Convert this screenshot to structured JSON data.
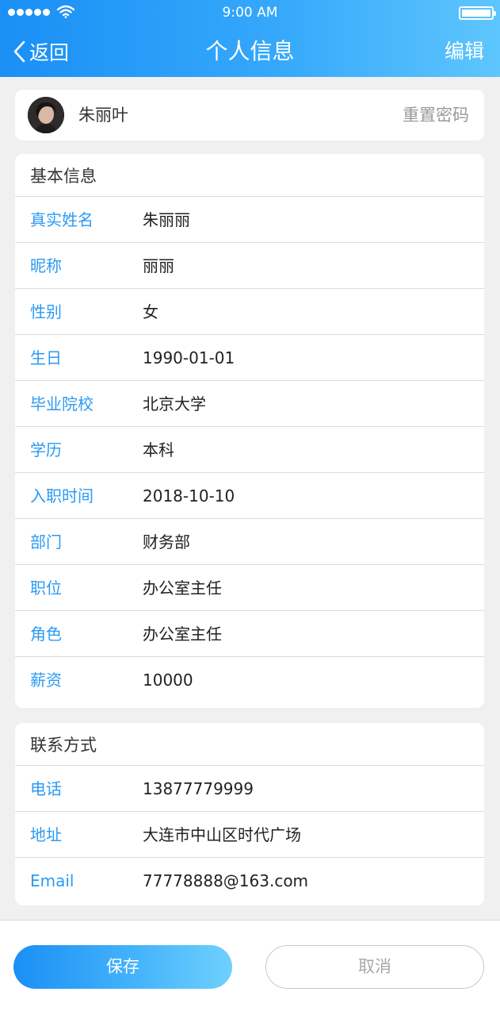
{
  "status_bar": {
    "time": "9:00 AM"
  },
  "nav": {
    "back_label": "返回",
    "title": "个人信息",
    "edit_label": "编辑"
  },
  "profile": {
    "name": "朱丽叶",
    "reset_password": "重置密码"
  },
  "basic_info": {
    "title": "基本信息",
    "rows": [
      {
        "label": "真实姓名",
        "value": "朱丽丽"
      },
      {
        "label": "昵称",
        "value": "丽丽"
      },
      {
        "label": "性别",
        "value": "女"
      },
      {
        "label": "生日",
        "value": "1990-01-01"
      },
      {
        "label": "毕业院校",
        "value": "北京大学"
      },
      {
        "label": "学历",
        "value": "本科"
      },
      {
        "label": "入职时间",
        "value": "2018-10-10"
      },
      {
        "label": "部门",
        "value": "财务部"
      },
      {
        "label": "职位",
        "value": "办公室主任"
      },
      {
        "label": "角色",
        "value": "办公室主任"
      },
      {
        "label": "薪资",
        "value": "10000"
      }
    ]
  },
  "contact": {
    "title": "联系方式",
    "rows": [
      {
        "label": "电话",
        "value": "13877779999"
      },
      {
        "label": "地址",
        "value": "大连市中山区时代广场"
      },
      {
        "label": "Email",
        "value": "77778888@163.com"
      }
    ]
  },
  "footer": {
    "save_label": "保存",
    "cancel_label": "取消"
  },
  "colors": {
    "accent": "#2b9af3",
    "header_start": "#1a8ff5",
    "header_end": "#5ec6fd",
    "background": "#f0f0f0"
  }
}
